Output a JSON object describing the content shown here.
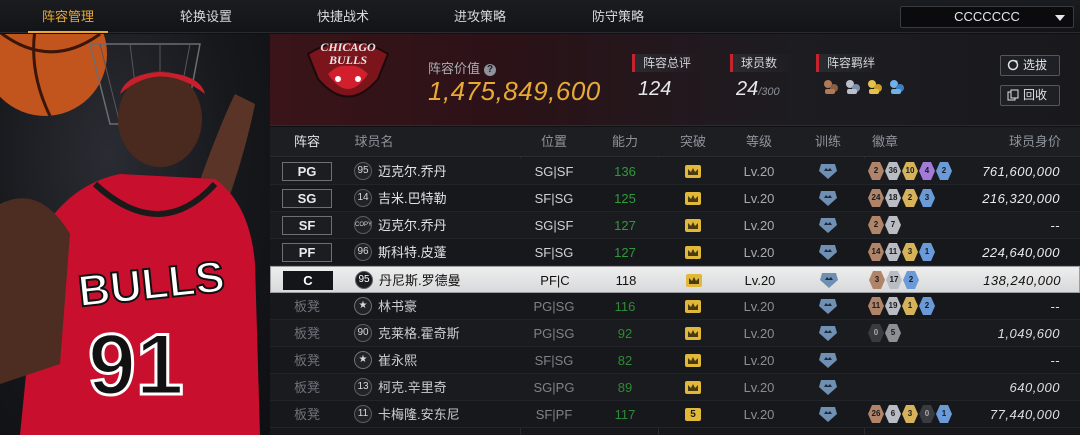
{
  "nav": {
    "tabs": [
      {
        "label": "阵容管理",
        "active": true
      },
      {
        "label": "轮换设置",
        "active": false
      },
      {
        "label": "快捷战术",
        "active": false
      },
      {
        "label": "进攻策略",
        "active": false
      },
      {
        "label": "防守策略",
        "active": false
      }
    ],
    "account_name": "CCCCCCC"
  },
  "team": {
    "logo_text": "CHICAGO BULLS",
    "value_label": "阵容价值",
    "value": "1,475,849,600",
    "overall_label": "阵容总评",
    "overall": "124",
    "players_label": "球员数",
    "players_count": "24",
    "players_max": "/300",
    "bonds_label": "阵容羁绊",
    "bonds": [
      "bond-icon-1",
      "bond-icon-2",
      "bond-icon-3",
      "bond-icon-4"
    ],
    "btn_select": "选拔",
    "btn_recycle": "回收"
  },
  "columns": [
    "阵容",
    "球员名",
    "位置",
    "能力",
    "突破",
    "等级",
    "训练",
    "徽章",
    "球员身价"
  ],
  "rows": [
    {
      "slot": "PG",
      "bench": false,
      "jersey": "95",
      "name": "迈克尔.乔丹",
      "position": "SG|SF",
      "rating": "136",
      "break": "",
      "level": "Lv.20",
      "badges": [
        [
          "bronze",
          "2"
        ],
        [
          "silver",
          "36"
        ],
        [
          "gold",
          "10"
        ],
        [
          "purple",
          "4"
        ],
        [
          "blue",
          "2"
        ]
      ],
      "value": "761,600,000"
    },
    {
      "slot": "SG",
      "bench": false,
      "jersey": "14",
      "name": "吉米.巴特勒",
      "position": "SF|SG",
      "rating": "125",
      "break": "",
      "level": "Lv.20",
      "badges": [
        [
          "bronze",
          "24"
        ],
        [
          "silver",
          "18"
        ],
        [
          "gold",
          "2"
        ],
        [
          "blue",
          "3"
        ]
      ],
      "value": "216,320,000"
    },
    {
      "slot": "SF",
      "bench": false,
      "jersey": "COPY",
      "name": "迈克尔.乔丹",
      "position": "SG|SF",
      "rating": "127",
      "break": "",
      "level": "Lv.20",
      "badges": [
        [
          "bronze",
          "2"
        ],
        [
          "silver",
          "7"
        ]
      ],
      "value": "--"
    },
    {
      "slot": "PF",
      "bench": false,
      "jersey": "96",
      "name": "斯科特.皮蓬",
      "position": "SF|SG",
      "rating": "127",
      "break": "",
      "level": "Lv.20",
      "badges": [
        [
          "bronze",
          "14"
        ],
        [
          "silver",
          "11"
        ],
        [
          "gold",
          "3"
        ],
        [
          "blue",
          "1"
        ]
      ],
      "value": "224,640,000"
    },
    {
      "slot": "C",
      "bench": false,
      "selected": true,
      "jersey": "95",
      "name": "丹尼斯.罗德曼",
      "position": "PF|C",
      "rating": "118",
      "break": "",
      "level": "Lv.20",
      "badges": [
        [
          "bronze",
          "3"
        ],
        [
          "silver",
          "17"
        ],
        [
          "blue",
          "2"
        ]
      ],
      "value": "138,240,000"
    },
    {
      "slot": "板凳",
      "bench": true,
      "jersey": "★",
      "name": "林书豪",
      "position": "PG|SG",
      "rating": "116",
      "break": "",
      "level": "Lv.20",
      "badges": [
        [
          "bronze",
          "11"
        ],
        [
          "silver",
          "19"
        ],
        [
          "gold",
          "1"
        ],
        [
          "blue",
          "2"
        ]
      ],
      "value": "--"
    },
    {
      "slot": "板凳",
      "bench": true,
      "jersey": "90",
      "name": "克莱格.霍奇斯",
      "position": "PG|SG",
      "rating": "92",
      "break": "",
      "level": "Lv.20",
      "badges": [
        [
          "black",
          "0"
        ],
        [
          "gray",
          "5"
        ]
      ],
      "value": "1,049,600"
    },
    {
      "slot": "板凳",
      "bench": true,
      "jersey": "★",
      "name": "崔永熙",
      "position": "SF|SG",
      "rating": "82",
      "break": "",
      "level": "Lv.20",
      "badges": [],
      "value": "--"
    },
    {
      "slot": "板凳",
      "bench": true,
      "jersey": "13",
      "name": "柯克.辛里奇",
      "position": "SG|PG",
      "rating": "89",
      "break": "",
      "level": "Lv.20",
      "badges": [],
      "value": "640,000"
    },
    {
      "slot": "板凳",
      "bench": true,
      "jersey": "11",
      "name": "卡梅隆.安东尼",
      "position": "SF|PF",
      "rating": "117",
      "break": "5",
      "level": "Lv.20",
      "badges": [
        [
          "bronze",
          "26"
        ],
        [
          "silver",
          "6"
        ],
        [
          "gold",
          "3"
        ],
        [
          "black",
          "0"
        ],
        [
          "blue",
          "1"
        ]
      ],
      "value": "77,440,000"
    }
  ],
  "colors": {
    "accent": "#e8a935",
    "red": "#c5242e",
    "green": "#2f9a3a",
    "crown": "#e2b83a"
  }
}
